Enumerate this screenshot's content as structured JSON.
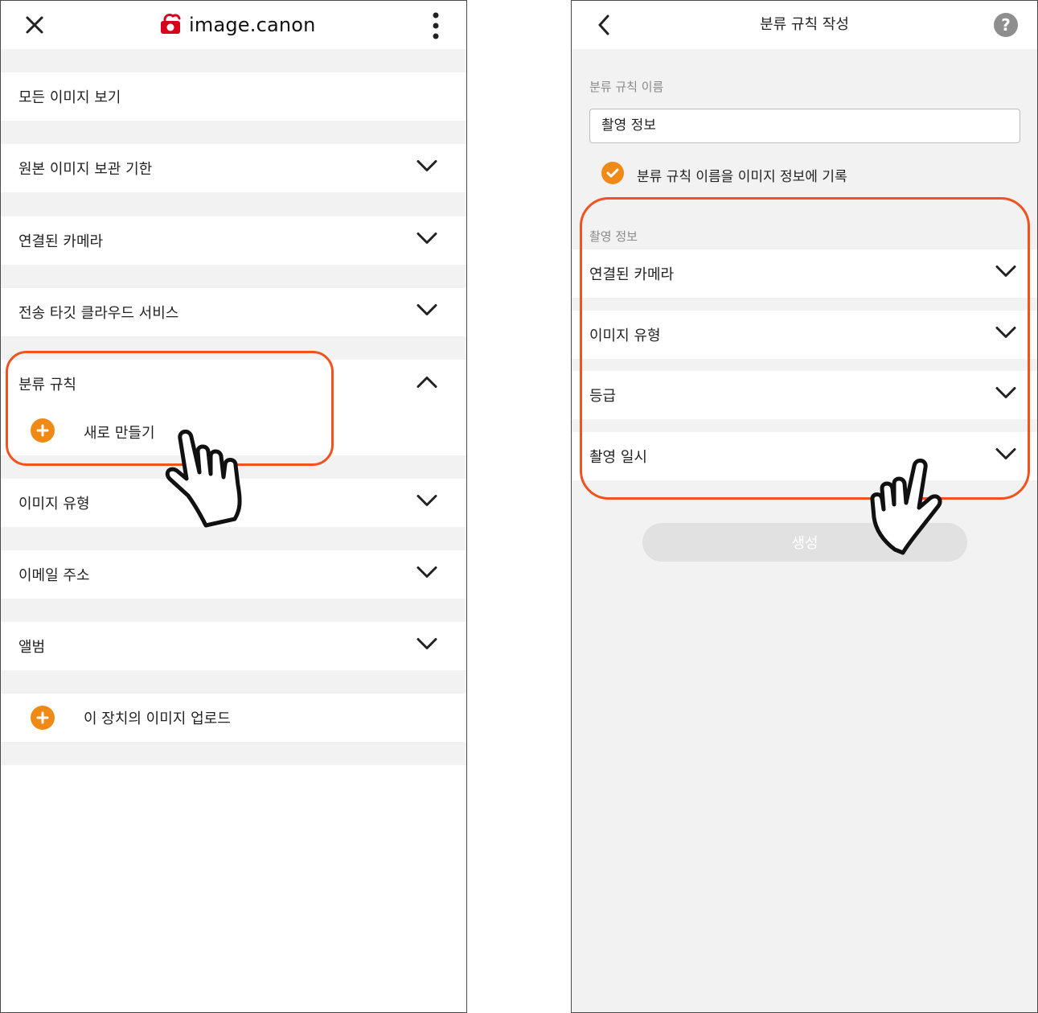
{
  "left": {
    "header": {
      "close_icon": "close-icon",
      "logo_text": "image.canon",
      "menu_icon": "more-vertical-icon"
    },
    "menu": [
      {
        "label": "모든 이미지 보기",
        "chevron": "none"
      },
      {
        "label": "원본 이미지 보관 기한",
        "chevron": "down"
      },
      {
        "label": "연결된 카메라",
        "chevron": "down"
      },
      {
        "label": "전송 타깃 클라우드 서비스",
        "chevron": "down"
      },
      {
        "label": "분류 규칙",
        "chevron": "up"
      },
      {
        "label": "이미지 유형",
        "chevron": "down"
      },
      {
        "label": "이메일 주소",
        "chevron": "down"
      },
      {
        "label": "앨범",
        "chevron": "down"
      }
    ],
    "create_new_label": "새로 만들기",
    "upload_label": "이 장치의 이미지 업로드"
  },
  "right": {
    "header": {
      "back_icon": "chevron-left-icon",
      "title": "분류 규칙 작성",
      "help_text": "?"
    },
    "name_label": "분류 규칙 이름",
    "name_value": "촬영 정보",
    "record_checkbox": {
      "label": "분류 규칙 이름을 이미지 정보에 기록",
      "checked": true
    },
    "section_label": "촬영 정보",
    "conditions": [
      {
        "label": "연결된 카메라"
      },
      {
        "label": "이미지 유형"
      },
      {
        "label": "등급"
      },
      {
        "label": "촬영 일시"
      }
    ],
    "create_button": "생성",
    "create_button_enabled": false
  },
  "colors": {
    "accent_orange": "#f08a16",
    "callout_red": "#f0531e",
    "canon_red": "#d7001d",
    "background_gray": "#f2f2f2"
  }
}
